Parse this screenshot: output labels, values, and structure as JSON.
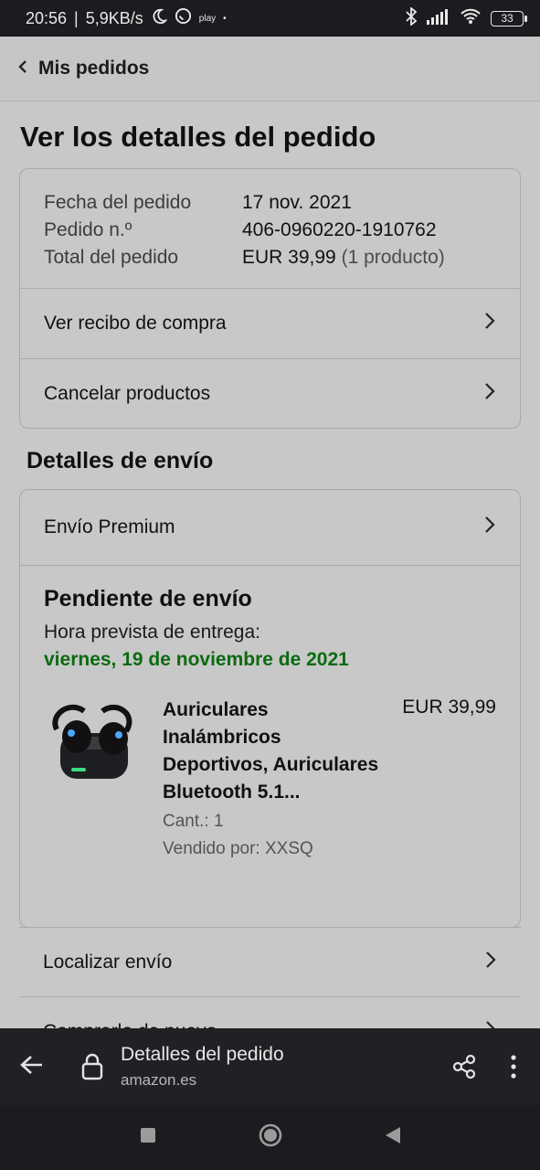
{
  "status_bar": {
    "time": "20:56",
    "speed": "5,9KB/s",
    "play_label": "play",
    "battery": "33",
    "icons": [
      "moon-icon",
      "whatsapp-icon",
      "bluetooth-icon",
      "signal-icon",
      "wifi-icon",
      "battery-icon"
    ]
  },
  "nav": {
    "back_label": "Mis pedidos"
  },
  "page_title": "Ver los detalles del pedido",
  "order": {
    "date_label": "Fecha del pedido",
    "date_value": "17 nov. 2021",
    "number_label": "Pedido n.º",
    "number_value": "406-0960220-1910762",
    "total_label": "Total del pedido",
    "total_value": "EUR 39,99",
    "total_count": "(1 producto)"
  },
  "order_links": [
    {
      "label": "Ver recibo de compra"
    },
    {
      "label": "Cancelar productos"
    }
  ],
  "shipping": {
    "section_title": "Detalles de envío",
    "method": "Envío Premium",
    "status_title": "Pendiente de envío",
    "eta_label": "Hora prevista de entrega:",
    "eta_date": "viernes, 19 de noviembre de 2021",
    "product": {
      "name": "Auriculares Inalámbricos Deportivos, Auriculares Bluetooth 5.1...",
      "price": "EUR 39,99",
      "quantity": "Cant.: 1",
      "seller": "Vendido por: XXSQ"
    }
  },
  "actions": [
    {
      "label": "Localizar envío"
    },
    {
      "label": "Comprarlo de nuevo"
    }
  ],
  "browser": {
    "page_title": "Detalles del pedido",
    "domain": "amazon.es"
  },
  "colors": {
    "eta": "#0b6b11",
    "background": "#c8c8c8",
    "dark_bar": "#202124"
  }
}
